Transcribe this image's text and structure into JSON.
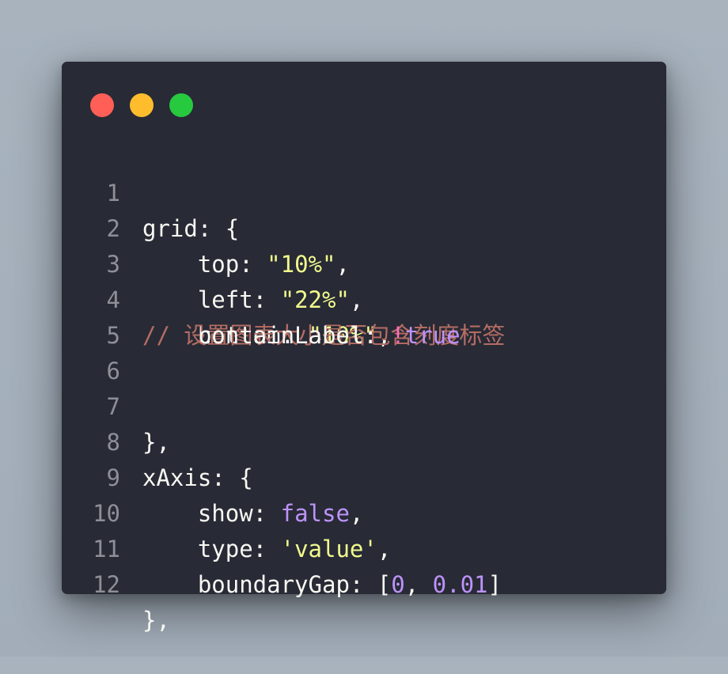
{
  "window": {
    "traffic_lights": [
      "red",
      "yellow",
      "green"
    ]
  },
  "code": {
    "lines": [
      {
        "n": "1",
        "t": "grid: {"
      },
      {
        "n": "2",
        "indent": "    ",
        "key": "top: ",
        "str": "\"10%\"",
        "tail": ","
      },
      {
        "n": "3",
        "indent": "    ",
        "key": "left: ",
        "str": "\"22%\"",
        "tail": ","
      },
      {
        "n": "4",
        "indent": "    ",
        "key": "bottom: ",
        "str": "\"10%\"",
        "tail": ","
      },
      {
        "n": "5",
        "t": ""
      },
      {
        "n": "6",
        "comment": "// 设置图表大小是否包含刻度标签",
        "key": "    containLabel: ",
        "bang": "!",
        "val": "true"
      },
      {
        "n": "7",
        "t": "},"
      },
      {
        "n": "8",
        "t": "xAxis: {"
      },
      {
        "n": "9",
        "indent": "    ",
        "key": "show: ",
        "kw": "false",
        "tail": ","
      },
      {
        "n": "10",
        "indent": "    ",
        "key": "type: ",
        "str": "'value'",
        "tail": ","
      },
      {
        "n": "11",
        "indent": "    ",
        "key": "boundaryGap: [",
        "num1": "0",
        "sep": ", ",
        "num2": "0.01",
        "tail": "]"
      },
      {
        "n": "12",
        "t": "},"
      }
    ]
  },
  "colors": {
    "background": "#a8b3be",
    "editor_bg": "#282a36",
    "text": "#f8f8f2",
    "string": "#f1fa8c",
    "keyword": "#bd93f9",
    "comment": "#b46d63",
    "line_number": "#8e8f96"
  }
}
